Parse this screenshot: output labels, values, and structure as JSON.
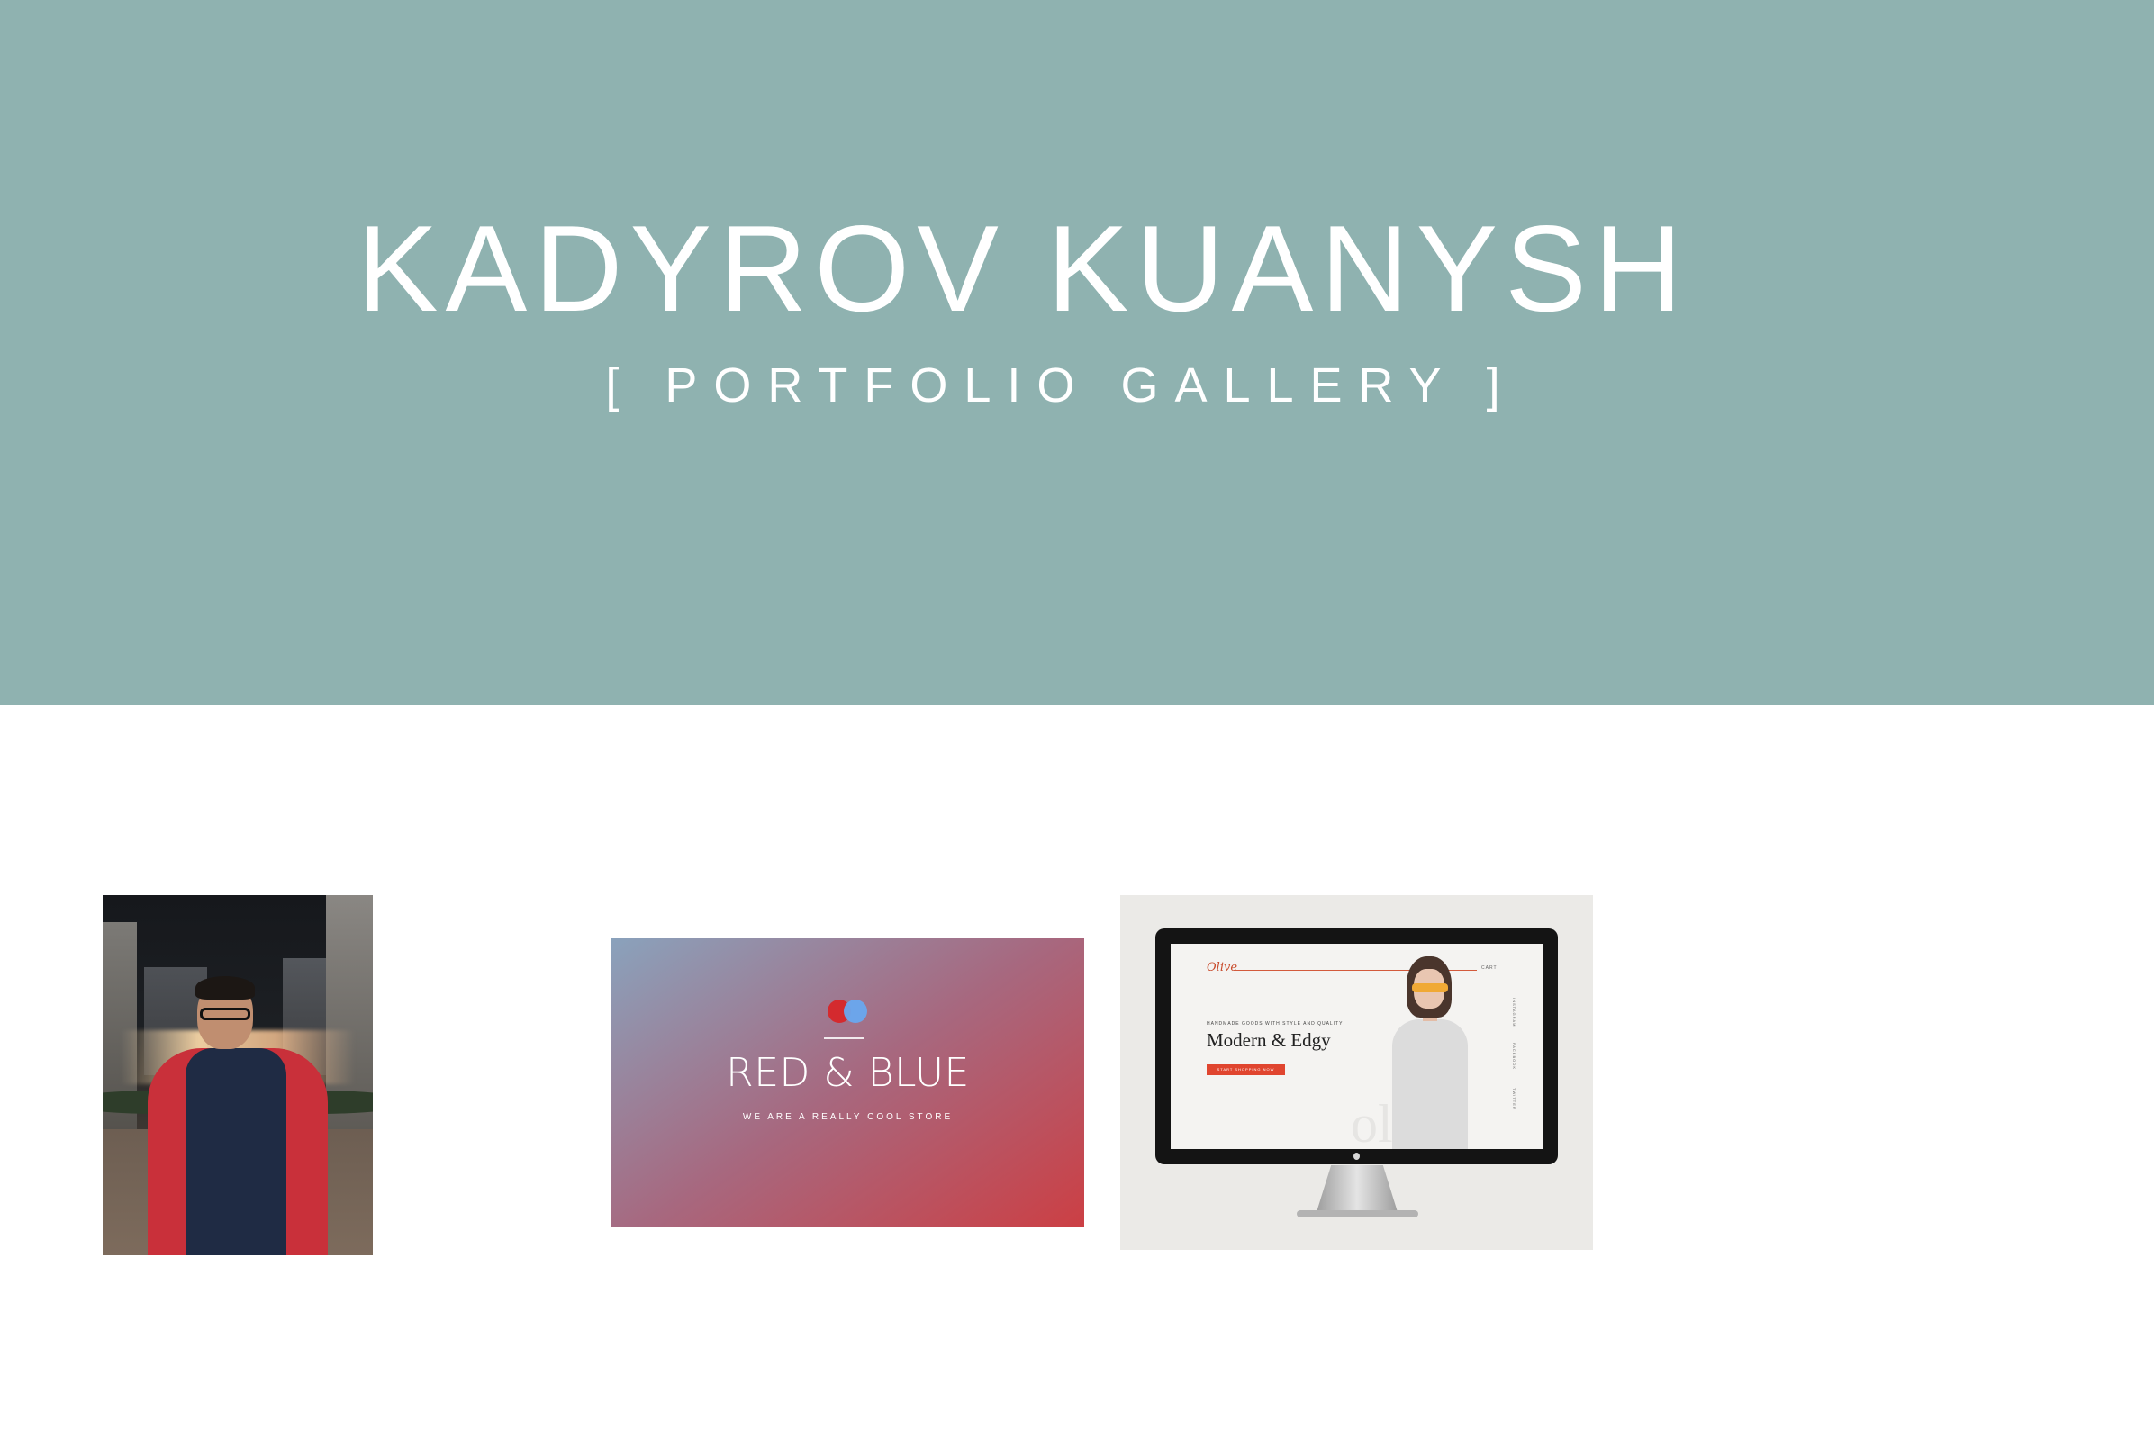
{
  "header": {
    "title": "KADYROV KUANYSH",
    "subtitle": "[ PORTFOLIO GALLERY ]",
    "background_color": "#8fb2b0"
  },
  "gallery": {
    "items": [
      {
        "kind": "photo",
        "alt": "portrait photo"
      },
      {
        "kind": "project-card",
        "title": "RED & BLUE",
        "tagline": "WE ARE A REALLY COOL STORE",
        "colors": {
          "red": "#d42a2e",
          "blue": "#69a8ef"
        }
      },
      {
        "kind": "project-mockup",
        "brand": "Olive",
        "headline": "Modern & Edgy",
        "kicker": "HANDMADE GOODS WITH STYLE AND QUALITY",
        "cta": "START SHOPPING NOW",
        "menu": "CART",
        "side_nav": [
          "INSTAGRAM",
          "FACEBOOK",
          "TWITTER"
        ],
        "watermark": "olive"
      }
    ]
  }
}
